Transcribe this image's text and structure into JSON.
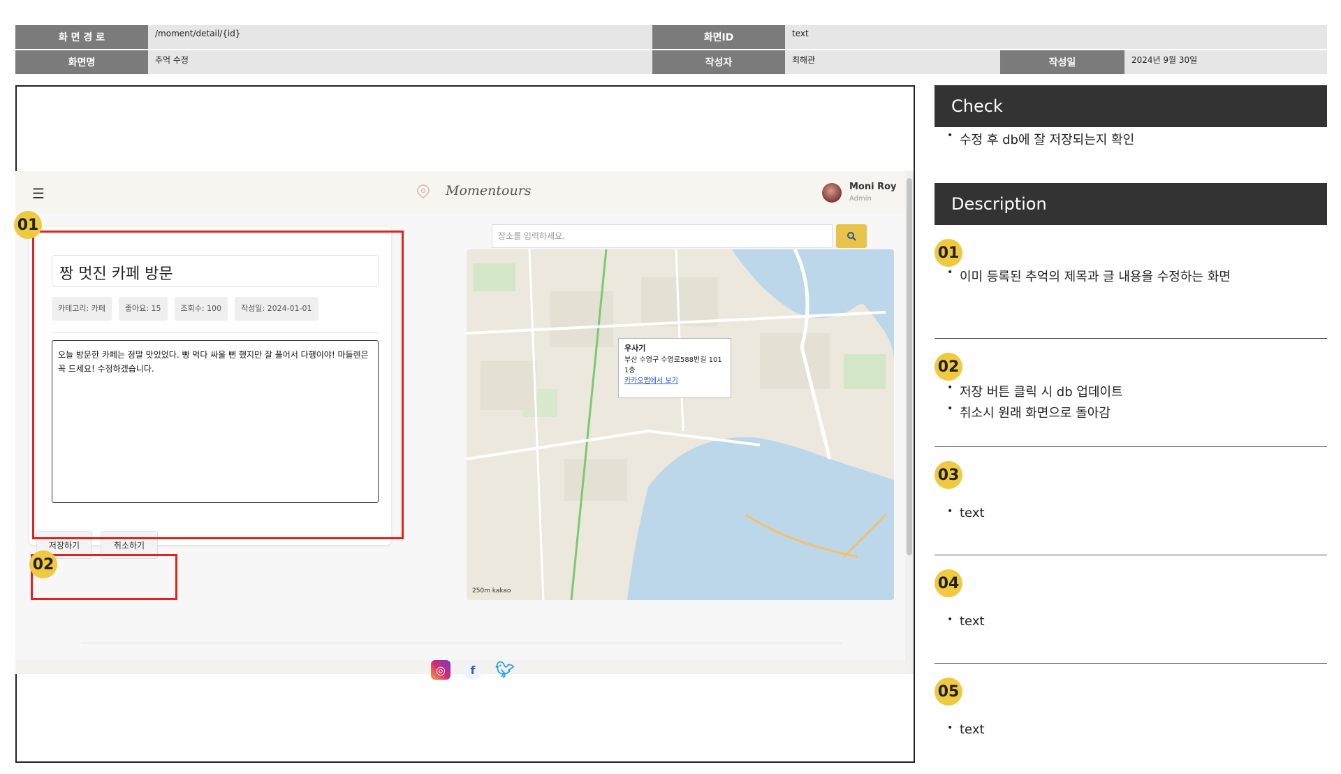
{
  "spec": {
    "path_label": "화 면 경 로",
    "path_value": "/moment/detail/{id}",
    "screen_id_label": "화면ID",
    "screen_id_value": "text",
    "name_label": "화면명",
    "name_value": "추억 수정",
    "author_label": "작성자",
    "author_value": "최해관",
    "date_label": "작성일",
    "date_value": "2024년 9월 30일"
  },
  "app": {
    "logo_text": "Momentours",
    "user_name": "Moni Roy",
    "user_role": "Admin",
    "memory": {
      "title": "짱 멋진 카페 방문",
      "chips": [
        "카테고리: 카페",
        "좋아요: 15",
        "조회수: 100",
        "작성일: 2024-01-01"
      ],
      "body": "오늘 방문한 카페는 정말 맛있었다. 빵 먹다 싸울 뻔 했지만 잘 풀어서 다행이야! 마들렌은 꼭 드세요! 수정하겠습니다."
    },
    "save_label": "저장하기",
    "cancel_label": "취소하기",
    "search_placeholder": "장소를 입력하세요.",
    "map_popup": {
      "title": "우사기",
      "address": "부산 수영구 수영로588번길 101 1층",
      "link": "카카오맵에서 보기"
    },
    "map_scale": "250m  kakao"
  },
  "markers": [
    "01",
    "02"
  ],
  "check": {
    "title": "Check",
    "items": [
      "수정 후 db에 잘 저장되는지 확인"
    ]
  },
  "description": {
    "title": "Description",
    "items": [
      {
        "num": "01",
        "bullets": [
          "이미 등록된 추억의 제목과 글 내용을 수정하는 화면"
        ]
      },
      {
        "num": "02",
        "bullets": [
          "저장 버튼 클릭 시 db 업데이트",
          "취소시 원래 화면으로 돌아감"
        ]
      },
      {
        "num": "03",
        "bullets": [
          "text"
        ]
      },
      {
        "num": "04",
        "bullets": [
          "text"
        ]
      },
      {
        "num": "05",
        "bullets": [
          "text"
        ]
      }
    ]
  },
  "colors": {
    "badge": "#efc93f",
    "marker_red": "#e0231c",
    "panel_header": "#333333",
    "spec_label": "#7b7b7b"
  }
}
